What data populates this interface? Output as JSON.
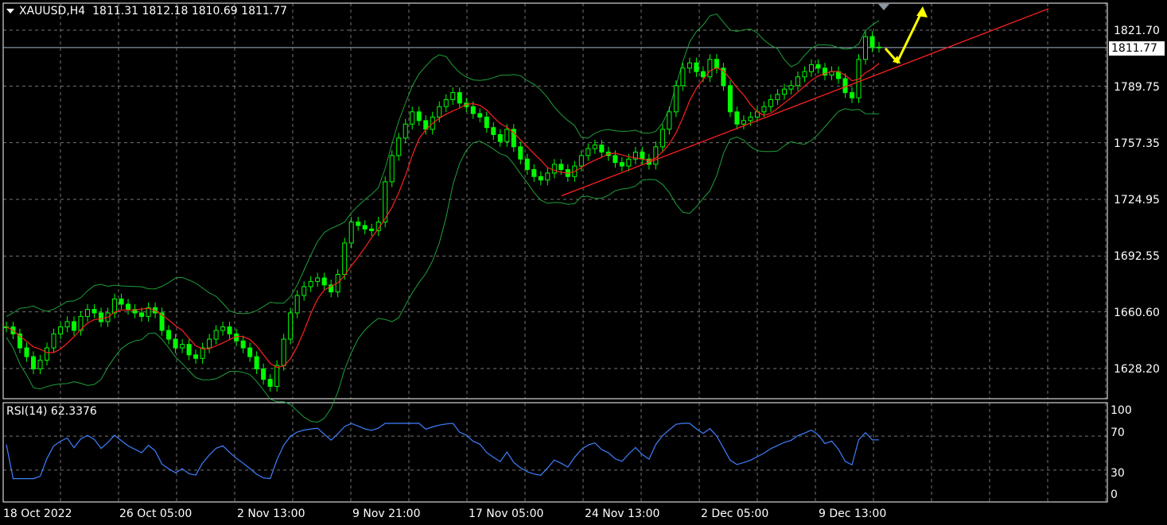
{
  "header": {
    "symbol_timeframe": "XAUUSD,H4",
    "ohlc": "1811.31 1812.18 1810.69 1811.77"
  },
  "current_price": "1811.77",
  "price_axis": [
    "1821.70",
    "1789.75",
    "1757.35",
    "1724.95",
    "1692.55",
    "1660.60",
    "1628.20"
  ],
  "rsi": {
    "label": "RSI(14) 62.3376",
    "levels": [
      "100",
      "70",
      "30",
      "0"
    ]
  },
  "time_axis": [
    "18 Oct 2022",
    "26 Oct 05:00",
    "2 Nov 13:00",
    "9 Nov 21:00",
    "17 Nov 05:00",
    "24 Nov 13:00",
    "2 Dec 05:00",
    "9 Dec 13:00"
  ],
  "colors": {
    "background": "#000000",
    "grid": "#c0c0c0",
    "bull_candle": "#00ff00",
    "bands": "#1e9e3a",
    "moving_average": "#ff2020",
    "trendline": "#ff2020",
    "rsi_line": "#3f7fff",
    "annotation_arrows": "#ffff00"
  },
  "chart_data": {
    "type": "line",
    "title": "XAUUSD,H4",
    "ylim": [
      1613,
      1835
    ],
    "x": [
      "18 Oct 2022",
      "26 Oct 05:00",
      "2 Nov 13:00",
      "9 Nov 21:00",
      "17 Nov 05:00",
      "24 Nov 13:00",
      "2 Dec 05:00",
      "9 Dec 13:00"
    ],
    "series": [
      {
        "kind": "close",
        "values": [
          1652,
          1648,
          1640,
          1635,
          1628,
          1633,
          1640,
          1648,
          1652,
          1655,
          1650,
          1658,
          1662,
          1660,
          1655,
          1660,
          1668,
          1665,
          1662,
          1660,
          1658,
          1663,
          1660,
          1650,
          1645,
          1640,
          1642,
          1636,
          1634,
          1640,
          1645,
          1650,
          1652,
          1648,
          1644,
          1640,
          1635,
          1628,
          1622,
          1618,
          1630,
          1645,
          1660,
          1670,
          1675,
          1678,
          1680,
          1676,
          1672,
          1682,
          1700,
          1712,
          1710,
          1708,
          1707,
          1712,
          1735,
          1750,
          1760,
          1768,
          1775,
          1770,
          1765,
          1772,
          1778,
          1782,
          1786,
          1780,
          1778,
          1774,
          1772,
          1766,
          1762,
          1758,
          1765,
          1755,
          1748,
          1742,
          1738,
          1736,
          1740,
          1745,
          1742,
          1738,
          1744,
          1750,
          1754,
          1756,
          1752,
          1750,
          1746,
          1744,
          1748,
          1752,
          1748,
          1745,
          1755,
          1765,
          1775,
          1790,
          1800,
          1803,
          1798,
          1795,
          1805,
          1800,
          1790,
          1775,
          1768,
          1770,
          1772,
          1775,
          1778,
          1782,
          1785,
          1788,
          1790,
          1795,
          1798,
          1802,
          1800,
          1796,
          1798,
          1794,
          1786,
          1783,
          1805,
          1818,
          1812,
          1812
        ]
      }
    ]
  }
}
